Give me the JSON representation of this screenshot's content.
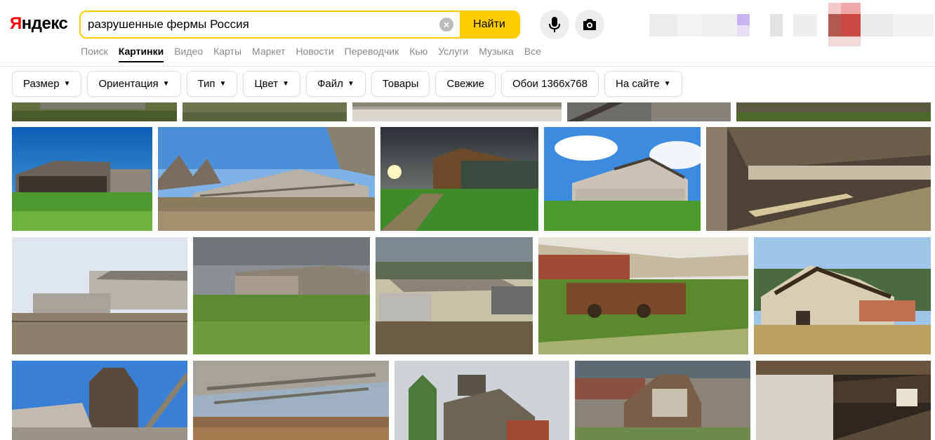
{
  "logo": {
    "first": "Я",
    "rest": "ндекс"
  },
  "search": {
    "query": "разрушенные фермы Россия",
    "button": "Найти"
  },
  "tabs": [
    "Поиск",
    "Картинки",
    "Видео",
    "Карты",
    "Маркет",
    "Новости",
    "Переводчик",
    "Кью",
    "Услуги",
    "Музыка",
    "Все"
  ],
  "filters": {
    "size": "Размер",
    "orientation": "Ориентация",
    "type": "Тип",
    "color": "Цвет",
    "file": "Файл",
    "goods": "Товары",
    "fresh": "Свежие",
    "wallpaper": "Обои 1366x768",
    "onsite": "На сайте"
  },
  "colors": {
    "accent": "#ffcc00",
    "logo_red": "#ff0000"
  }
}
